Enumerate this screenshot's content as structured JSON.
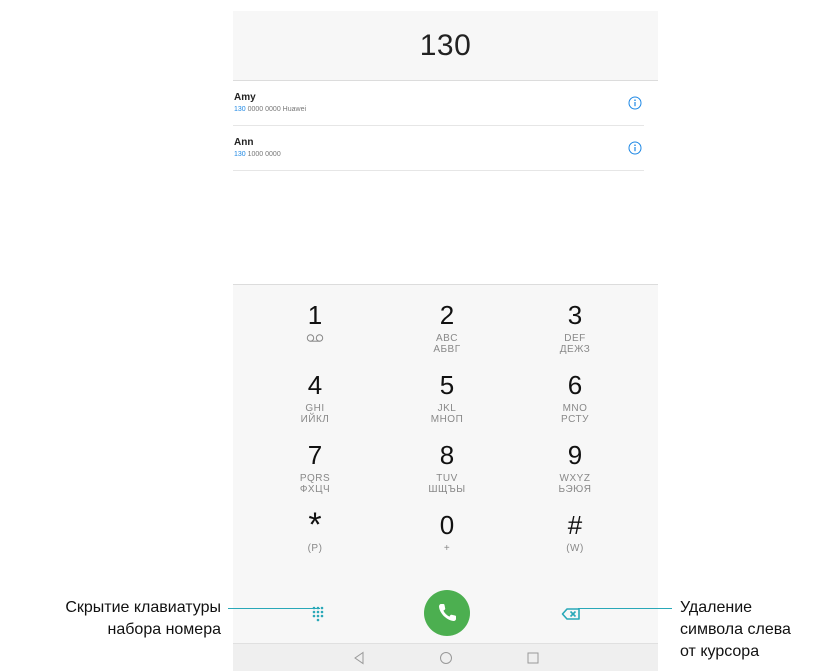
{
  "dialer": {
    "number": "130",
    "contacts": [
      {
        "name": "Amy",
        "match": "130",
        "rest": " 0000 0000 Huawei"
      },
      {
        "name": "Ann",
        "match": "130",
        "rest": " 1000 0000"
      }
    ],
    "keys": [
      {
        "digit": "1",
        "sub1": "",
        "sub2": "",
        "icon": "voicemail-icon"
      },
      {
        "digit": "2",
        "sub1": "ABC",
        "sub2": "АБВГ"
      },
      {
        "digit": "3",
        "sub1": "DEF",
        "sub2": "ДЕЖЗ"
      },
      {
        "digit": "4",
        "sub1": "GHI",
        "sub2": "ИЙКЛ"
      },
      {
        "digit": "5",
        "sub1": "JKL",
        "sub2": "МНОП"
      },
      {
        "digit": "6",
        "sub1": "MNO",
        "sub2": "РСТУ"
      },
      {
        "digit": "7",
        "sub1": "PQRS",
        "sub2": "ФХЦЧ"
      },
      {
        "digit": "8",
        "sub1": "TUV",
        "sub2": "ШЩЪЫ"
      },
      {
        "digit": "9",
        "sub1": "WXYZ",
        "sub2": "ЬЭЮЯ"
      },
      {
        "digit": "*",
        "sub1": "(P)",
        "sub2": ""
      },
      {
        "digit": "0",
        "sub1": "+",
        "sub2": ""
      },
      {
        "digit": "#",
        "sub1": "(W)",
        "sub2": ""
      }
    ],
    "colors": {
      "call": "#4caf50",
      "accent": "#1e88e5",
      "leader": "#29a8b8"
    }
  },
  "annotations": {
    "left_line1": "Скрытие клавиатуры",
    "left_line2": "набора номера",
    "right_line1": "Удаление",
    "right_line2": "символа слева",
    "right_line3": "от курсора"
  }
}
